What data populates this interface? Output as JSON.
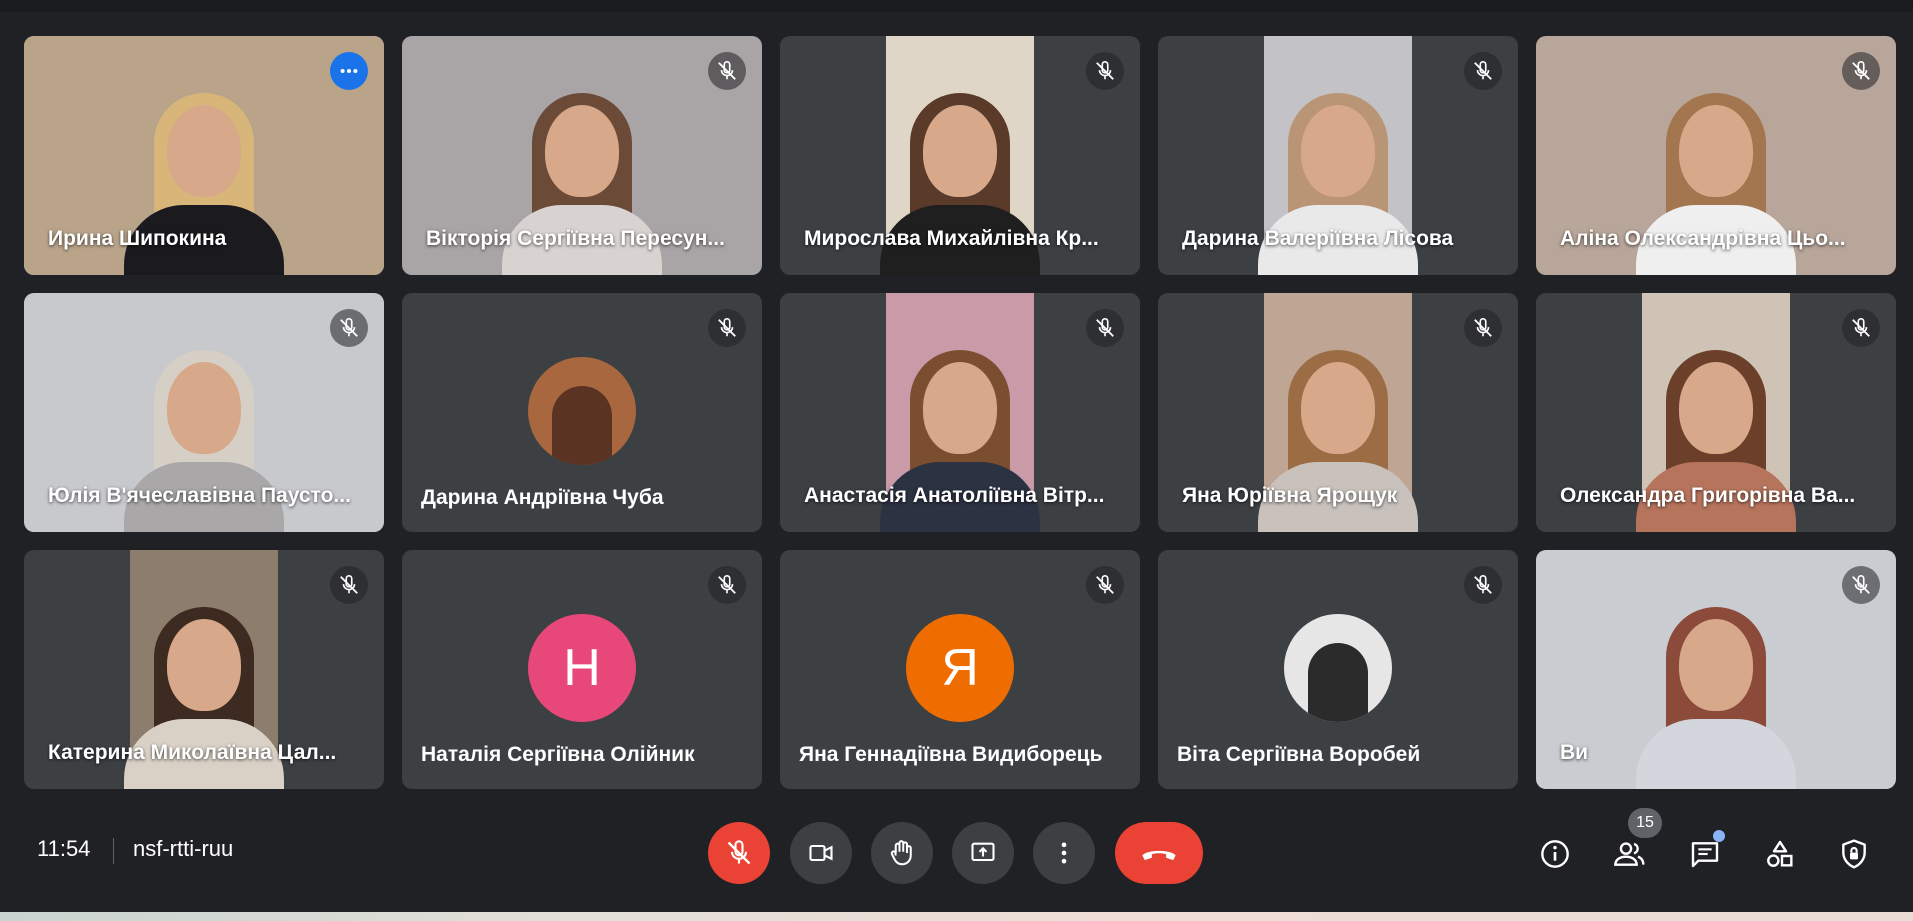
{
  "meeting": {
    "time": "11:54",
    "code": "nsf-rtti-ruu",
    "participant_count": "15"
  },
  "participants": [
    {
      "name": "Ирина Шипокина",
      "type": "video",
      "muted": false,
      "active": true,
      "bg": "#b9a48a",
      "hair": "#d8b67a",
      "shirt": "#1b1b1f"
    },
    {
      "name": "Вікторія Сергіївна Пересун...",
      "type": "video",
      "muted": true,
      "bg": "#a9a4a6",
      "hair": "#6b4a37",
      "shirt": "#d8d3d0"
    },
    {
      "name": "Мирослава Михайлівна Кр...",
      "type": "video",
      "muted": true,
      "bg": "#e0d6c8",
      "hair": "#5a3a28",
      "shirt": "#1f1f1f"
    },
    {
      "name": "Дарина Валеріївна Лісова",
      "type": "video",
      "muted": true,
      "bg": "#c3c2c6",
      "hair": "#b99576",
      "shirt": "#e9e9ea"
    },
    {
      "name": "Аліна Олександрівна Цьо...",
      "type": "video",
      "muted": true,
      "bg": "#b8a69b",
      "hair": "#a4764f",
      "shirt": "#efefef"
    },
    {
      "name": "Юлія В'ячеславівна Паусто...",
      "type": "video",
      "muted": true,
      "bg": "#c8c9cd",
      "hair": "#d6cfc6",
      "shirt": "#a9a7a8"
    },
    {
      "name": "Дарина Андріївна Чуба",
      "type": "photo-avatar",
      "muted": true,
      "avatar_color": "#a8673e"
    },
    {
      "name": "Анастасія Анатоліївна Вітр...",
      "type": "video",
      "muted": true,
      "bg": "#c99aa8",
      "hair": "#7a4e2f",
      "shirt": "#2b3242"
    },
    {
      "name": "Яна Юріївна Ярощук",
      "type": "video",
      "muted": true,
      "bg": "#bfa593",
      "hair": "#9c6d45",
      "shirt": "#c9c2bc"
    },
    {
      "name": "Олександра Григорівна Ва...",
      "type": "video",
      "muted": true,
      "bg": "#cfc3b6",
      "hair": "#6b3f2a",
      "shirt": "#b7745d"
    },
    {
      "name": "Катерина Миколаївна Цал...",
      "type": "video",
      "muted": true,
      "bg": "#8c7d6d",
      "hair": "#3d2b22",
      "shirt": "#d9d1c6"
    },
    {
      "name": "Наталія Сергіївна Олійник",
      "type": "letter-avatar",
      "muted": true,
      "letter": "Н",
      "avatar_color": "#e8477a"
    },
    {
      "name": "Яна Геннадіївна Видиборець",
      "type": "letter-avatar",
      "muted": true,
      "letter": "Я",
      "avatar_color": "#ef6c00"
    },
    {
      "name": "Віта Сергіївна Воробей",
      "type": "photo-avatar",
      "muted": true,
      "avatar_color": "#e6e6e6"
    },
    {
      "name": "Ви",
      "type": "video",
      "muted": true,
      "self": true,
      "bg": "#c9ccd0",
      "hair": "#8b4a3a",
      "shirt": "#d3d6dc"
    }
  ],
  "controls": {
    "mic": "mic-off",
    "camera": "camera",
    "raise_hand": "raise-hand",
    "present": "present-screen",
    "more": "more-options",
    "end": "end-call"
  },
  "right_panel": [
    "info",
    "people",
    "chat",
    "activities",
    "host-controls"
  ],
  "colors": {
    "background": "#202124",
    "tile": "#3c4043",
    "accent": "#8ab4f8",
    "danger": "#ea4335"
  }
}
